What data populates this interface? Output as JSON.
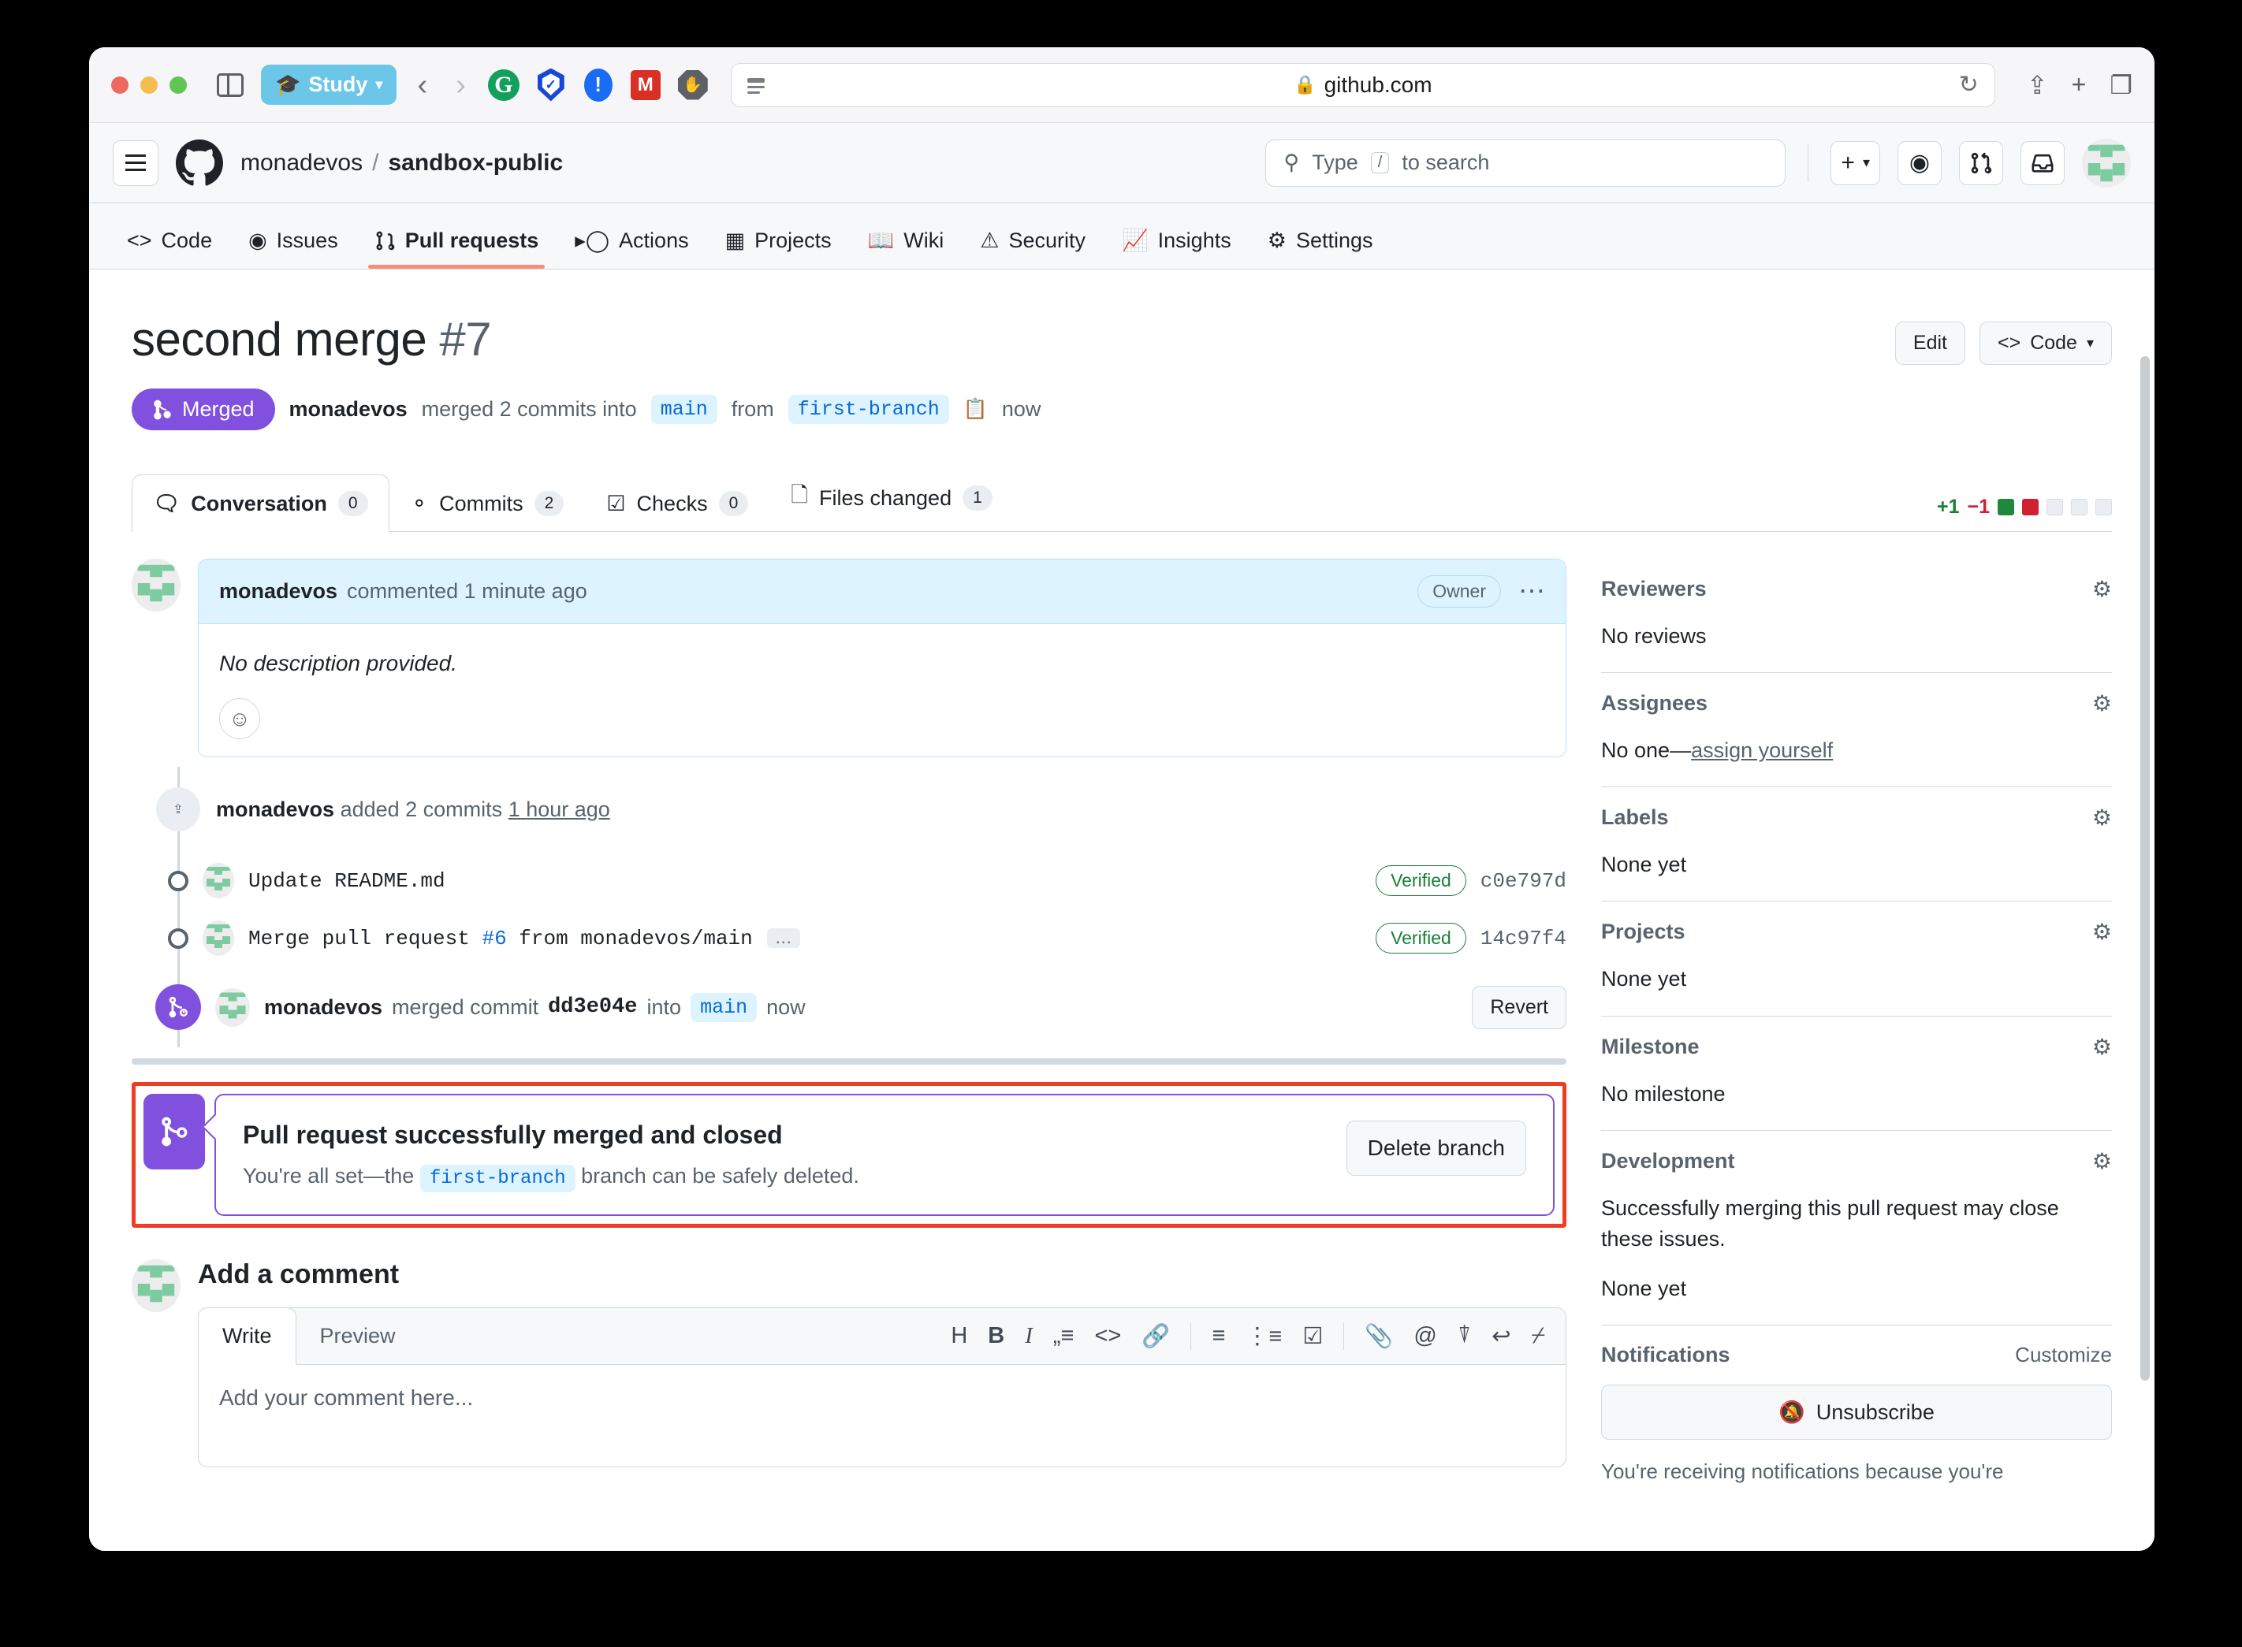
{
  "browser": {
    "profile_label": "Study",
    "url": "github.com",
    "lock_icon": "lock-icon",
    "back_icon": "back-arrow-icon",
    "forward_icon": "forward-arrow-icon",
    "reload_icon": "reload-icon",
    "share_icon": "share-icon",
    "newtab_icon": "plus-icon",
    "tabs_icon": "tab-overview-icon",
    "sidebar_icon": "sidebar-toggle-icon",
    "extensions": [
      "grammarly-icon",
      "adguard-icon",
      "lastpass-icon",
      "mendeley-icon",
      "adblock-icon"
    ]
  },
  "gh_header": {
    "hamburger_icon": "hamburger-menu-icon",
    "logo_icon": "github-logo-icon",
    "owner": "monadevos",
    "separator": "/",
    "repo": "sandbox-public",
    "search_placeholder": "Type",
    "search_key": "/",
    "search_suffix": "to search",
    "search_icon": "search-icon",
    "create_icon": "plus-icon",
    "create_chevron": "chevron-down-icon",
    "issues_icon": "issue-opened-icon",
    "pulls_icon": "git-pull-request-icon",
    "inbox_icon": "inbox-icon",
    "avatar": "user-avatar"
  },
  "repo_tabs": [
    {
      "label": "Code",
      "icon": "code-icon",
      "active": false
    },
    {
      "label": "Issues",
      "icon": "issue-opened-icon",
      "active": false
    },
    {
      "label": "Pull requests",
      "icon": "git-pull-request-icon",
      "active": true
    },
    {
      "label": "Actions",
      "icon": "play-icon",
      "active": false
    },
    {
      "label": "Projects",
      "icon": "table-icon",
      "active": false
    },
    {
      "label": "Wiki",
      "icon": "book-icon",
      "active": false
    },
    {
      "label": "Security",
      "icon": "shield-icon",
      "active": false
    },
    {
      "label": "Insights",
      "icon": "graph-icon",
      "active": false
    },
    {
      "label": "Settings",
      "icon": "gear-icon",
      "active": false
    }
  ],
  "pr": {
    "title": "second merge",
    "number": "#7",
    "edit_label": "Edit",
    "code_label": "Code",
    "code_icon": "code-icon",
    "code_chevron": "chevron-down-icon",
    "state_badge": "Merged",
    "state_icon": "git-merge-icon",
    "meta_author": "monadevos",
    "meta_action": "merged 2 commits into",
    "base_branch": "main",
    "meta_from": "from",
    "head_branch": "first-branch",
    "copy_icon": "copy-icon",
    "meta_time": "now"
  },
  "pr_tabs": [
    {
      "label": "Conversation",
      "count": "0",
      "icon": "comment-icon",
      "active": true
    },
    {
      "label": "Commits",
      "count": "2",
      "icon": "commit-icon",
      "active": false
    },
    {
      "label": "Checks",
      "count": "0",
      "icon": "checklist-icon",
      "active": false
    },
    {
      "label": "Files changed",
      "count": "1",
      "icon": "file-diff-icon",
      "active": false
    }
  ],
  "diffstat": {
    "additions": "+1",
    "deletions": "−1",
    "blocks": [
      "green",
      "red",
      "neutral",
      "neutral",
      "neutral"
    ]
  },
  "comment": {
    "author": "monadevos",
    "action": "commented 1 minute ago",
    "role_badge": "Owner",
    "menu_icon": "kebab-menu-icon",
    "body": "No description provided.",
    "react_icon": "emoji-reaction-icon"
  },
  "timeline": {
    "added_commits": {
      "icon": "commit-push-icon",
      "author": "monadevos",
      "text": "added 2 commits",
      "time": "1 hour ago"
    },
    "commits": [
      {
        "message": "Update README.md",
        "verified": "Verified",
        "sha": "c0e797d",
        "has_ellipsis": false
      },
      {
        "message_prefix": "Merge pull request",
        "message_link": "#6",
        "message_suffix": "from monadevos/main",
        "verified": "Verified",
        "sha": "14c97f4",
        "has_ellipsis": true,
        "ellipsis": "…"
      }
    ],
    "merged": {
      "icon": "git-merge-icon",
      "author": "monadevos",
      "action": "merged commit",
      "commit": "dd3e04e",
      "into": "into",
      "branch": "main",
      "time": "now",
      "revert_label": "Revert"
    }
  },
  "merge_banner": {
    "icon": "git-merge-icon",
    "heading": "Pull request successfully merged and closed",
    "body_prefix": "You're all set—the",
    "branch": "first-branch",
    "body_suffix": "branch can be safely deleted.",
    "delete_label": "Delete branch",
    "annotation_color": "#f03c20",
    "accent_color": "#8250df"
  },
  "add_comment": {
    "heading": "Add a comment",
    "write_tab": "Write",
    "preview_tab": "Preview",
    "placeholder": "Add your comment here...",
    "tools": [
      "heading-icon",
      "bold-icon",
      "italic-icon",
      "quote-icon",
      "code-icon",
      "link-icon",
      "ordered-list-icon",
      "unordered-list-icon",
      "task-list-icon",
      "attach-file-icon",
      "mention-icon",
      "reference-icon",
      "reply-icon",
      "slash-command-icon"
    ]
  },
  "sidebar": {
    "sections": [
      {
        "title": "Reviewers",
        "gear": "gear-icon",
        "body": "No reviews"
      },
      {
        "title": "Assignees",
        "gear": "gear-icon",
        "body_prefix": "No one—",
        "body_link": "assign yourself"
      },
      {
        "title": "Labels",
        "gear": "gear-icon",
        "body": "None yet"
      },
      {
        "title": "Projects",
        "gear": "gear-icon",
        "body": "None yet"
      },
      {
        "title": "Milestone",
        "gear": "gear-icon",
        "body": "No milestone"
      },
      {
        "title": "Development",
        "gear": "gear-icon",
        "body": "Successfully merging this pull request may close these issues.",
        "body2": "None yet"
      }
    ],
    "notifications": {
      "title": "Notifications",
      "customize": "Customize",
      "unsubscribe": "Unsubscribe",
      "bell_icon": "bell-slash-icon",
      "note": "You're receiving notifications because you're"
    }
  }
}
